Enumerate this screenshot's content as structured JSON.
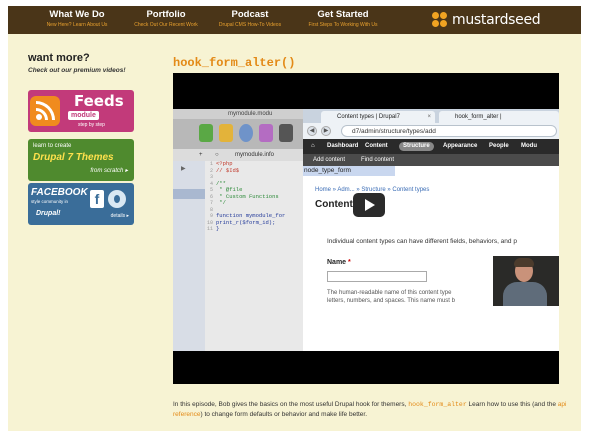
{
  "nav": [
    {
      "title": "What We Do",
      "sub": "New Here? Learn About Us"
    },
    {
      "title": "Portfolio",
      "sub": "Check Out Our Recent Work"
    },
    {
      "title": "Podcast",
      "sub": "Drupal CMS How-To Videos"
    },
    {
      "title": "Get Started",
      "sub": "First Steps To Working With Us"
    }
  ],
  "logo": {
    "text": "mustardseed",
    "icon": "mustardseed-logo-icon"
  },
  "sidebar": {
    "heading": "want more?",
    "subheading": "Check out our premium videos!",
    "promos": [
      {
        "title": "Feeds",
        "badge": "module",
        "sub": "step by step"
      },
      {
        "line1": "learn to create",
        "line2": "Drupal 7 Themes",
        "line3": "from scratch ▸"
      },
      {
        "line1": "FACEBOOK",
        "line2": "style community in",
        "line3": "Drupal!",
        "line4": "details ▸"
      }
    ]
  },
  "page": {
    "title": "hook_form_alter()"
  },
  "video": {
    "editor": {
      "title": "mymodule.modu",
      "tab": "mymodule.info",
      "line_numbers": [
        "1",
        "2",
        "3",
        "4",
        "5",
        "6",
        "7",
        "8",
        "9",
        "10",
        "11"
      ],
      "code": [
        {
          "text": "<?php",
          "cls": "c-red"
        },
        {
          "text": "// $Id$",
          "cls": "c-red"
        },
        {
          "text": "",
          "cls": ""
        },
        {
          "text": "/**",
          "cls": "c-green"
        },
        {
          "text": " * @file",
          "cls": "c-green"
        },
        {
          "text": " * Custom Functions",
          "cls": "c-green"
        },
        {
          "text": " */",
          "cls": "c-green"
        },
        {
          "text": "",
          "cls": ""
        },
        {
          "text": "function mymodule_for",
          "cls": "c-blue"
        },
        {
          "text": "print_r($form_id);",
          "cls": "c-blue"
        },
        {
          "text": "}",
          "cls": "c-blue"
        }
      ]
    },
    "browser": {
      "tab1": "Content types | Drupal7",
      "tab2": "hook_form_alter |",
      "url": "d7/admin/structure/types/add",
      "toolbar": [
        "Dashboard",
        "Content",
        "Structure",
        "Appearance",
        "People",
        "Modu"
      ],
      "active_toolbar": "Structure",
      "shortcuts": [
        "Add content",
        "Find content"
      ],
      "highlight": "node_type_form",
      "breadcrumb": "Home » Adm... » Structure » Content types",
      "heading": "Content types",
      "intro": "Individual content types can have different fields, behaviors, and p",
      "name_label": "Name",
      "required_mark": "*",
      "help": "The human-readable name of this content type\nletters, numbers, and spaces. This name must b"
    }
  },
  "description": {
    "text1": "In this episode, Bob gives the basics on the most useful Drupal hook for themers, ",
    "hook_link": "hook_form_alter",
    "text2": " Learn how to use this (and the ",
    "api_link": "api reference",
    "text3": ") to change form defaults or behavior and make life better."
  },
  "colors": {
    "nav_bg": "#4a3518",
    "accent": "#e38a17",
    "page_bg": "#f7f3d3"
  }
}
